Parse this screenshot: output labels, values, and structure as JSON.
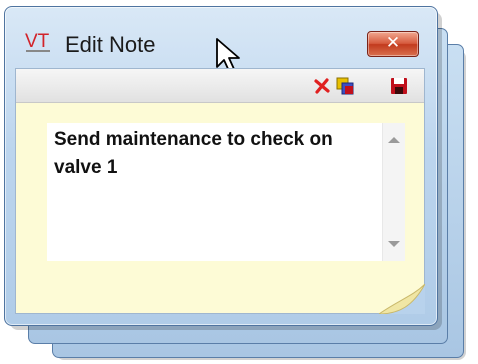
{
  "window": {
    "logo_text": "VT",
    "title": "Edit Note",
    "close_label": "✕"
  },
  "toolbar": {
    "buttons": [
      {
        "name": "delete",
        "icon": "red-x-icon",
        "color": "#e02020"
      },
      {
        "name": "color",
        "icon": "color-squares-icon",
        "color": "#e8c000"
      },
      {
        "name": "save",
        "icon": "floppy-disk-icon",
        "color": "#c0101c"
      }
    ]
  },
  "note": {
    "text": "Send maintenance to check on valve 1",
    "background": "#fdfbd6"
  },
  "colors": {
    "frame": "#b8d2ec",
    "close_button": "#c94a2c",
    "logo": "#d2232a"
  }
}
